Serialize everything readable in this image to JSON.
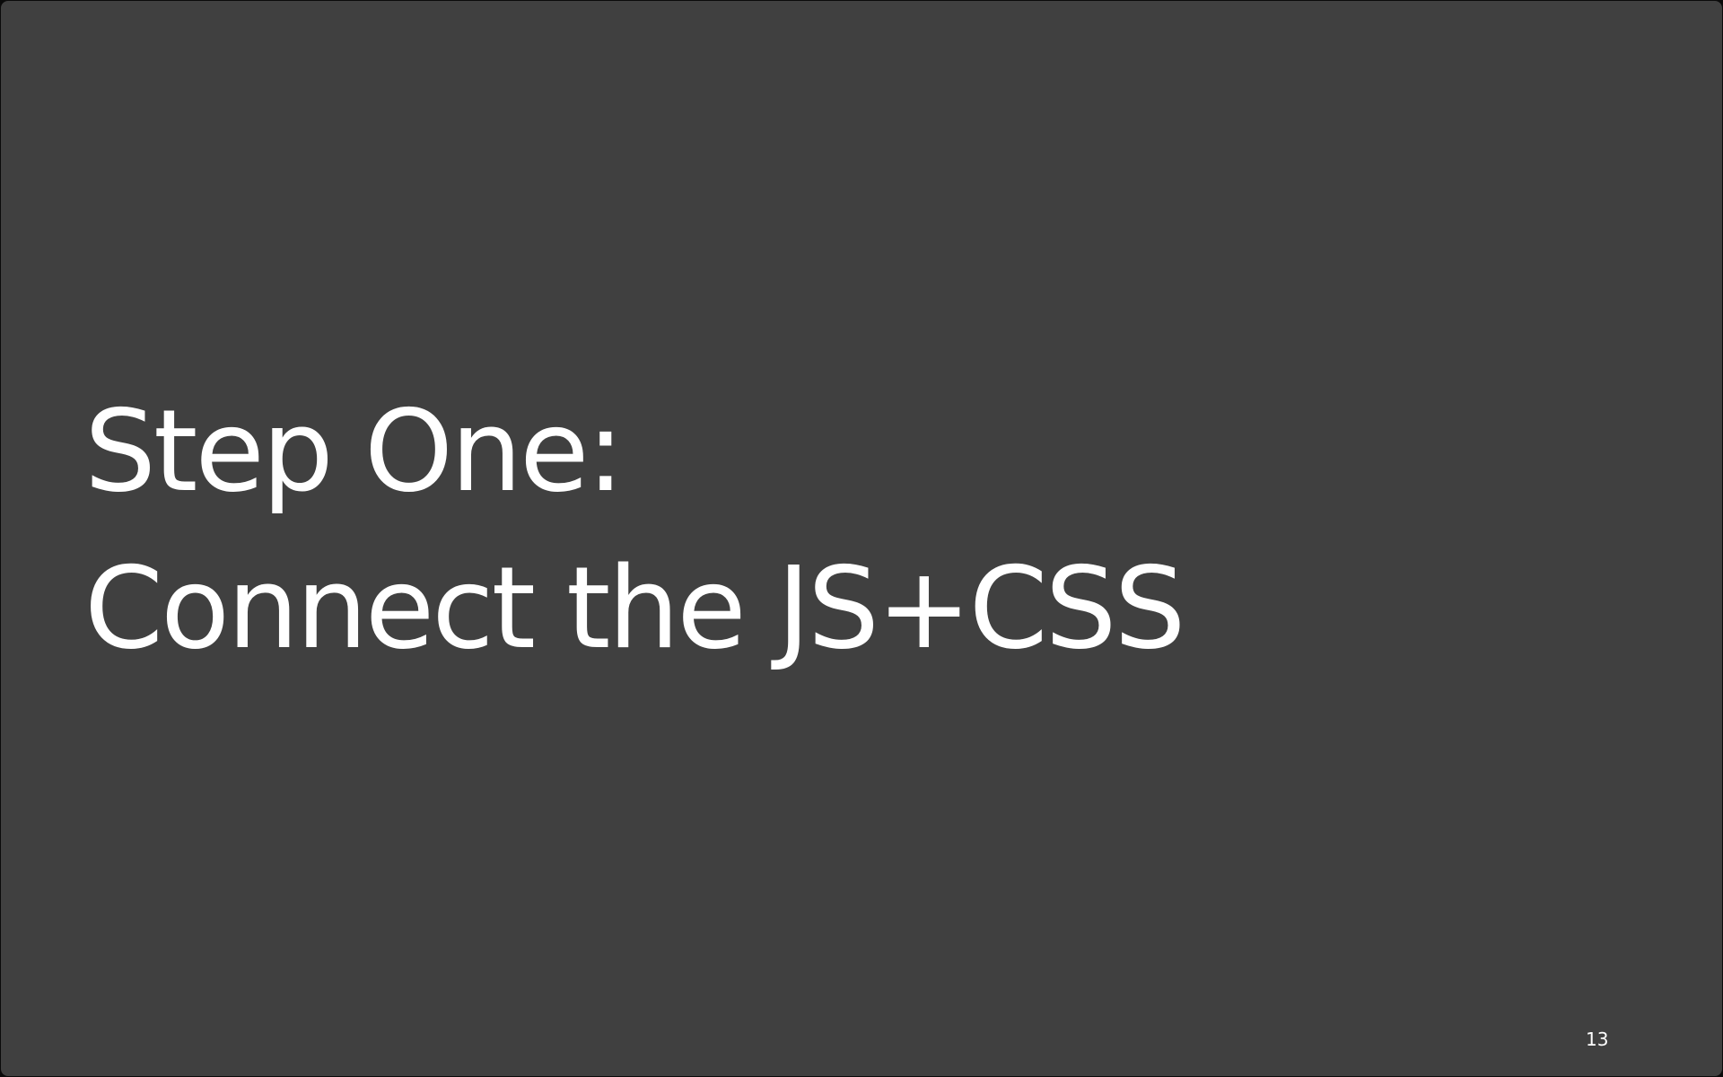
{
  "slide": {
    "title_line1": "Step One:",
    "title_line2": "Connect the JS+CSS",
    "page_number": "13"
  },
  "colors": {
    "background": "#404040",
    "text": "#ffffff"
  }
}
